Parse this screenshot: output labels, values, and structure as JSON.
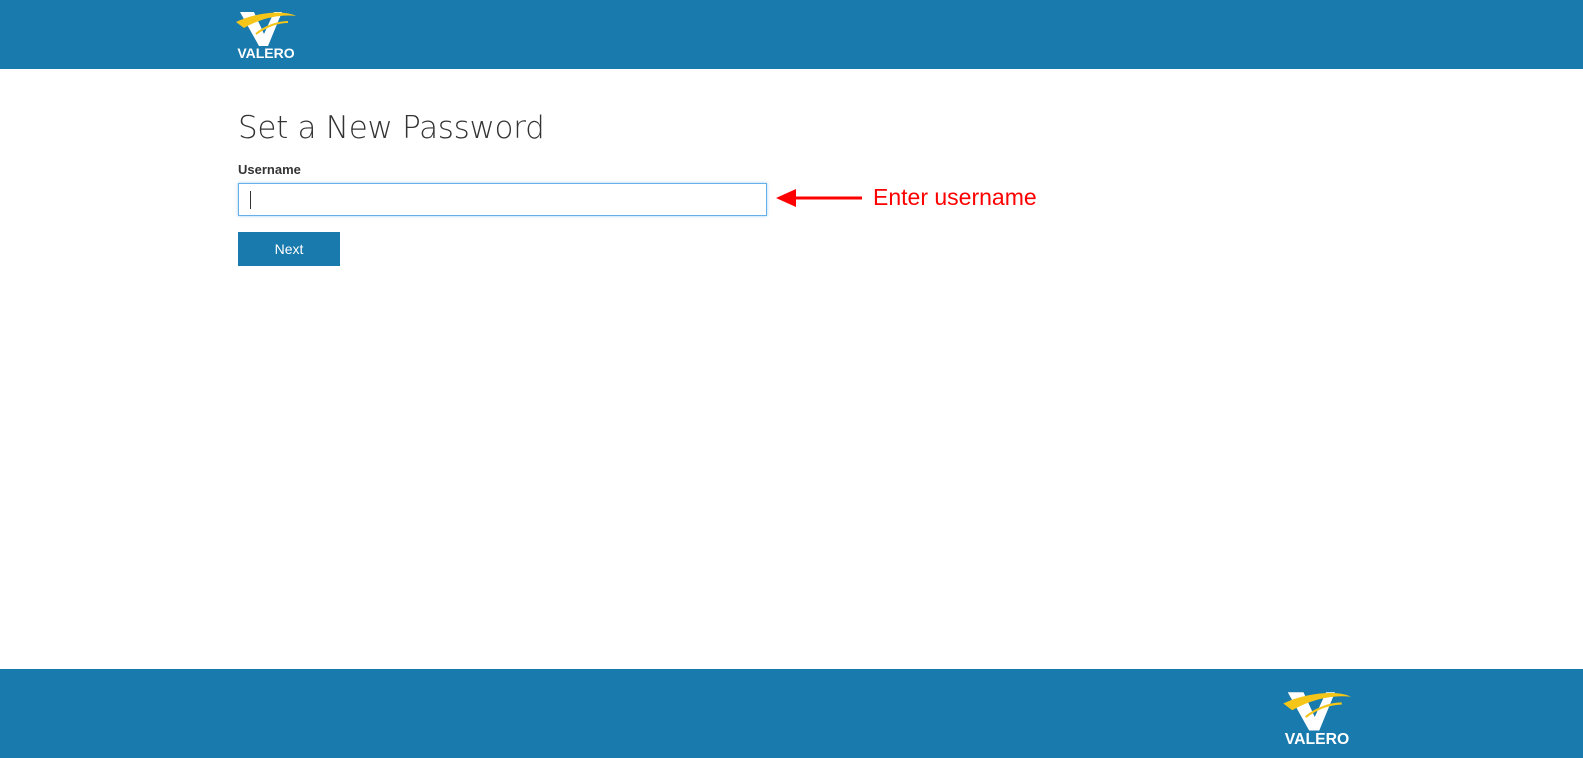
{
  "header": {
    "logo_text": "VALERO",
    "logo_icon": "valero-v-logo-icon"
  },
  "main": {
    "title": "Set a New Password",
    "username_label": "Username",
    "username_value": "",
    "next_label": "Next"
  },
  "annotation": {
    "text": "Enter username",
    "arrow_icon": "left-arrow-icon",
    "color": "#ff0000"
  },
  "footer": {
    "logo_text": "VALERO",
    "logo_icon": "valero-v-logo-icon"
  },
  "colors": {
    "brand_blue": "#187aad",
    "logo_yellow": "#f5c518",
    "focus_border": "#66afe9"
  }
}
